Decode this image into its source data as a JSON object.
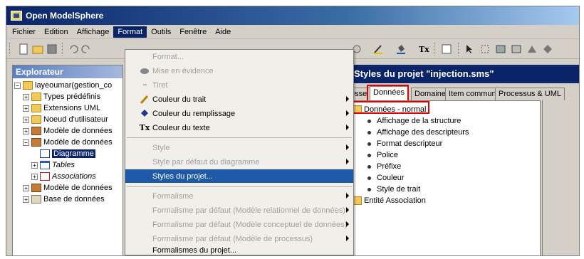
{
  "window": {
    "title": "Open ModelSphere"
  },
  "menubar": {
    "items": [
      "Fichier",
      "Edition",
      "Affichage",
      "Format",
      "Outils",
      "Fenêtre",
      "Aide"
    ]
  },
  "explorer": {
    "title": "Explorateur",
    "items": [
      {
        "label": "layeoumar(gestion_co",
        "icon": "project-icon"
      },
      {
        "label": "Types prédéfinis",
        "icon": "folder-icon"
      },
      {
        "label": "Extensions UML",
        "icon": "folder-icon"
      },
      {
        "label": "Noeud d'utilisateur",
        "icon": "folder-icon"
      },
      {
        "label": "Modèle de données",
        "icon": "model-icon"
      },
      {
        "label": "Modèle de données",
        "icon": "model-icon"
      },
      {
        "label": "Diagramme",
        "icon": "diagram-icon"
      },
      {
        "label": "Tables",
        "icon": "table-icon"
      },
      {
        "label": "Associations",
        "icon": "association-icon"
      },
      {
        "label": "Modèle de données",
        "icon": "model-icon"
      },
      {
        "label": "Base de données",
        "icon": "database-icon"
      }
    ]
  },
  "format_menu": {
    "items": [
      {
        "label": "Format...",
        "enabled": false
      },
      {
        "label": "Mise en évidence",
        "enabled": false,
        "icon": "highlight-icon"
      },
      {
        "label": "Tiret",
        "enabled": false,
        "icon": "dash-icon"
      },
      {
        "label": "Couleur du trait",
        "enabled": true,
        "icon": "pen-color-icon"
      },
      {
        "label": "Couleur du remplissage",
        "enabled": true,
        "icon": "fill-color-icon"
      },
      {
        "label": "Couleur du texte",
        "enabled": true,
        "icon": "text-color-icon"
      },
      {
        "label": "Style",
        "enabled": false
      },
      {
        "label": "Style par défaut du diagramme",
        "enabled": false
      },
      {
        "label": "Styles du projet...",
        "enabled": true,
        "highlighted": true
      },
      {
        "label": "Formalisme",
        "enabled": false
      },
      {
        "label": "Formalisme par défaut (Modèle relationnel de données)",
        "enabled": false
      },
      {
        "label": "Formalisme par défaut (Modèle conceptuel de données)",
        "enabled": false
      },
      {
        "label": "Formalisme par défaut (Modèle de processus)",
        "enabled": false
      },
      {
        "label": "Formalismes du projet...",
        "enabled": true
      }
    ],
    "glyphs": {
      "dash": "▪▪▪▪",
      "text_color": "Tx"
    }
  },
  "styles_dialog": {
    "title": "Styles du projet \"injection.sms\"",
    "tabs": [
      "esse",
      "Données",
      "Domaine",
      "Item commun",
      "Processus & UML"
    ],
    "active_tab": "Données",
    "tree": {
      "root": "Données - normal",
      "children": [
        "Affichage de la structure",
        "Affichage des descripteurs",
        "Format descripteur",
        "Police",
        "Préfixe",
        "Couleur",
        "Style de trait"
      ],
      "sibling": "Entité Association"
    }
  },
  "colors": {
    "highlight": "#1e5aa8",
    "title_bar": "#0a246a",
    "red_marker": "#e00000"
  }
}
